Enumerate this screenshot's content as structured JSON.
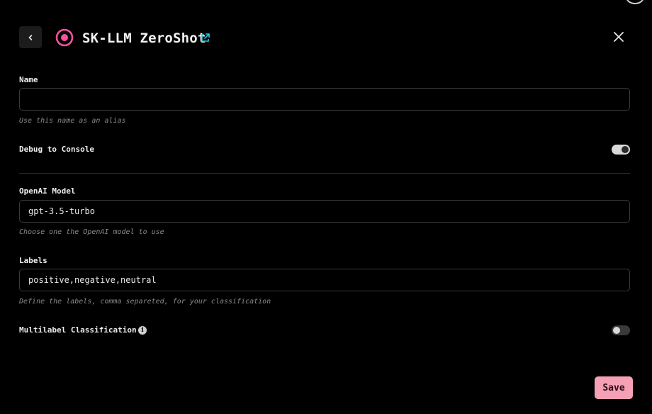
{
  "header": {
    "title": "SK-LLM ZeroShot",
    "accent_color": "#ff4fa0",
    "link_color": "#29c8e0"
  },
  "form": {
    "name": {
      "label": "Name",
      "value": "",
      "placeholder": "",
      "hint": "Use this name as an alias"
    },
    "debug": {
      "label": "Debug to Console",
      "enabled": true
    },
    "model": {
      "label": "OpenAI Model",
      "value": "gpt-3.5-turbo",
      "hint": "Choose one the OpenAI model to use"
    },
    "labels": {
      "label": "Labels",
      "value": "positive,negative,neutral",
      "hint": "Define the labels, comma separeted, for your classification"
    },
    "multilabel": {
      "label": "Multilabel Classification",
      "enabled": false
    }
  },
  "actions": {
    "save_label": "Save"
  }
}
